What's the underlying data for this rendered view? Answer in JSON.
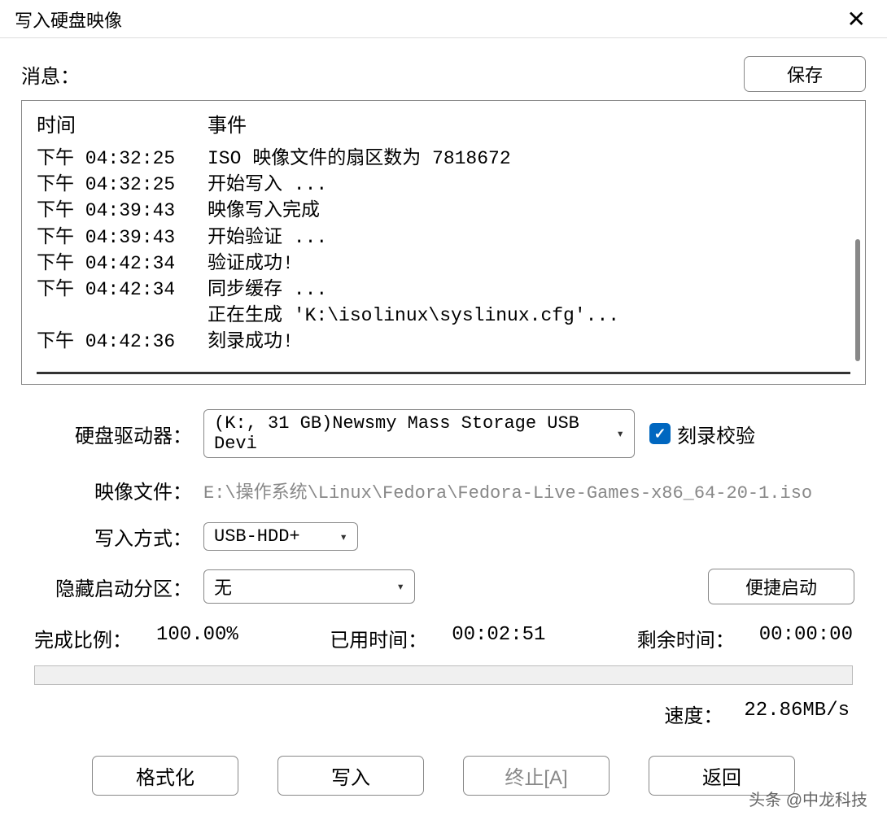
{
  "window": {
    "title": "写入硬盘映像"
  },
  "messages": {
    "label": "消息：",
    "save_button": "保存",
    "header_time": "时间",
    "header_event": "事件",
    "rows": [
      {
        "time": "下午 04:32:25",
        "event": "ISO 映像文件的扇区数为 7818672"
      },
      {
        "time": "下午 04:32:25",
        "event": "开始写入 ..."
      },
      {
        "time": "下午 04:39:43",
        "event": "映像写入完成"
      },
      {
        "time": "下午 04:39:43",
        "event": "开始验证 ..."
      },
      {
        "time": "下午 04:42:34",
        "event": "验证成功!"
      },
      {
        "time": "下午 04:42:34",
        "event": "同步缓存 ..."
      },
      {
        "time": "",
        "event": "正在生成 'K:\\isolinux\\syslinux.cfg'..."
      },
      {
        "time": "下午 04:42:36",
        "event": "刻录成功!"
      }
    ]
  },
  "form": {
    "drive_label": "硬盘驱动器：",
    "drive_value": "(K:, 31 GB)Newsmy Mass Storage USB Devi",
    "verify_label": "刻录校验",
    "verify_checked": true,
    "image_label": "映像文件：",
    "image_value": "E:\\操作系统\\Linux\\Fedora\\Fedora-Live-Games-x86_64-20-1.iso",
    "write_method_label": "写入方式：",
    "write_method_value": "USB-HDD+",
    "hide_partition_label": "隐藏启动分区：",
    "hide_partition_value": "无",
    "quick_boot_button": "便捷启动"
  },
  "progress": {
    "percent_label": "完成比例：",
    "percent_value": "100.00%",
    "elapsed_label": "已用时间：",
    "elapsed_value": "00:02:51",
    "remaining_label": "剩余时间：",
    "remaining_value": "00:00:00",
    "speed_label": "速度：",
    "speed_value": "22.86MB/s"
  },
  "actions": {
    "format": "格式化",
    "write": "写入",
    "abort": "终止[A]",
    "return": "返回"
  },
  "watermark": "头条 @中龙科技"
}
